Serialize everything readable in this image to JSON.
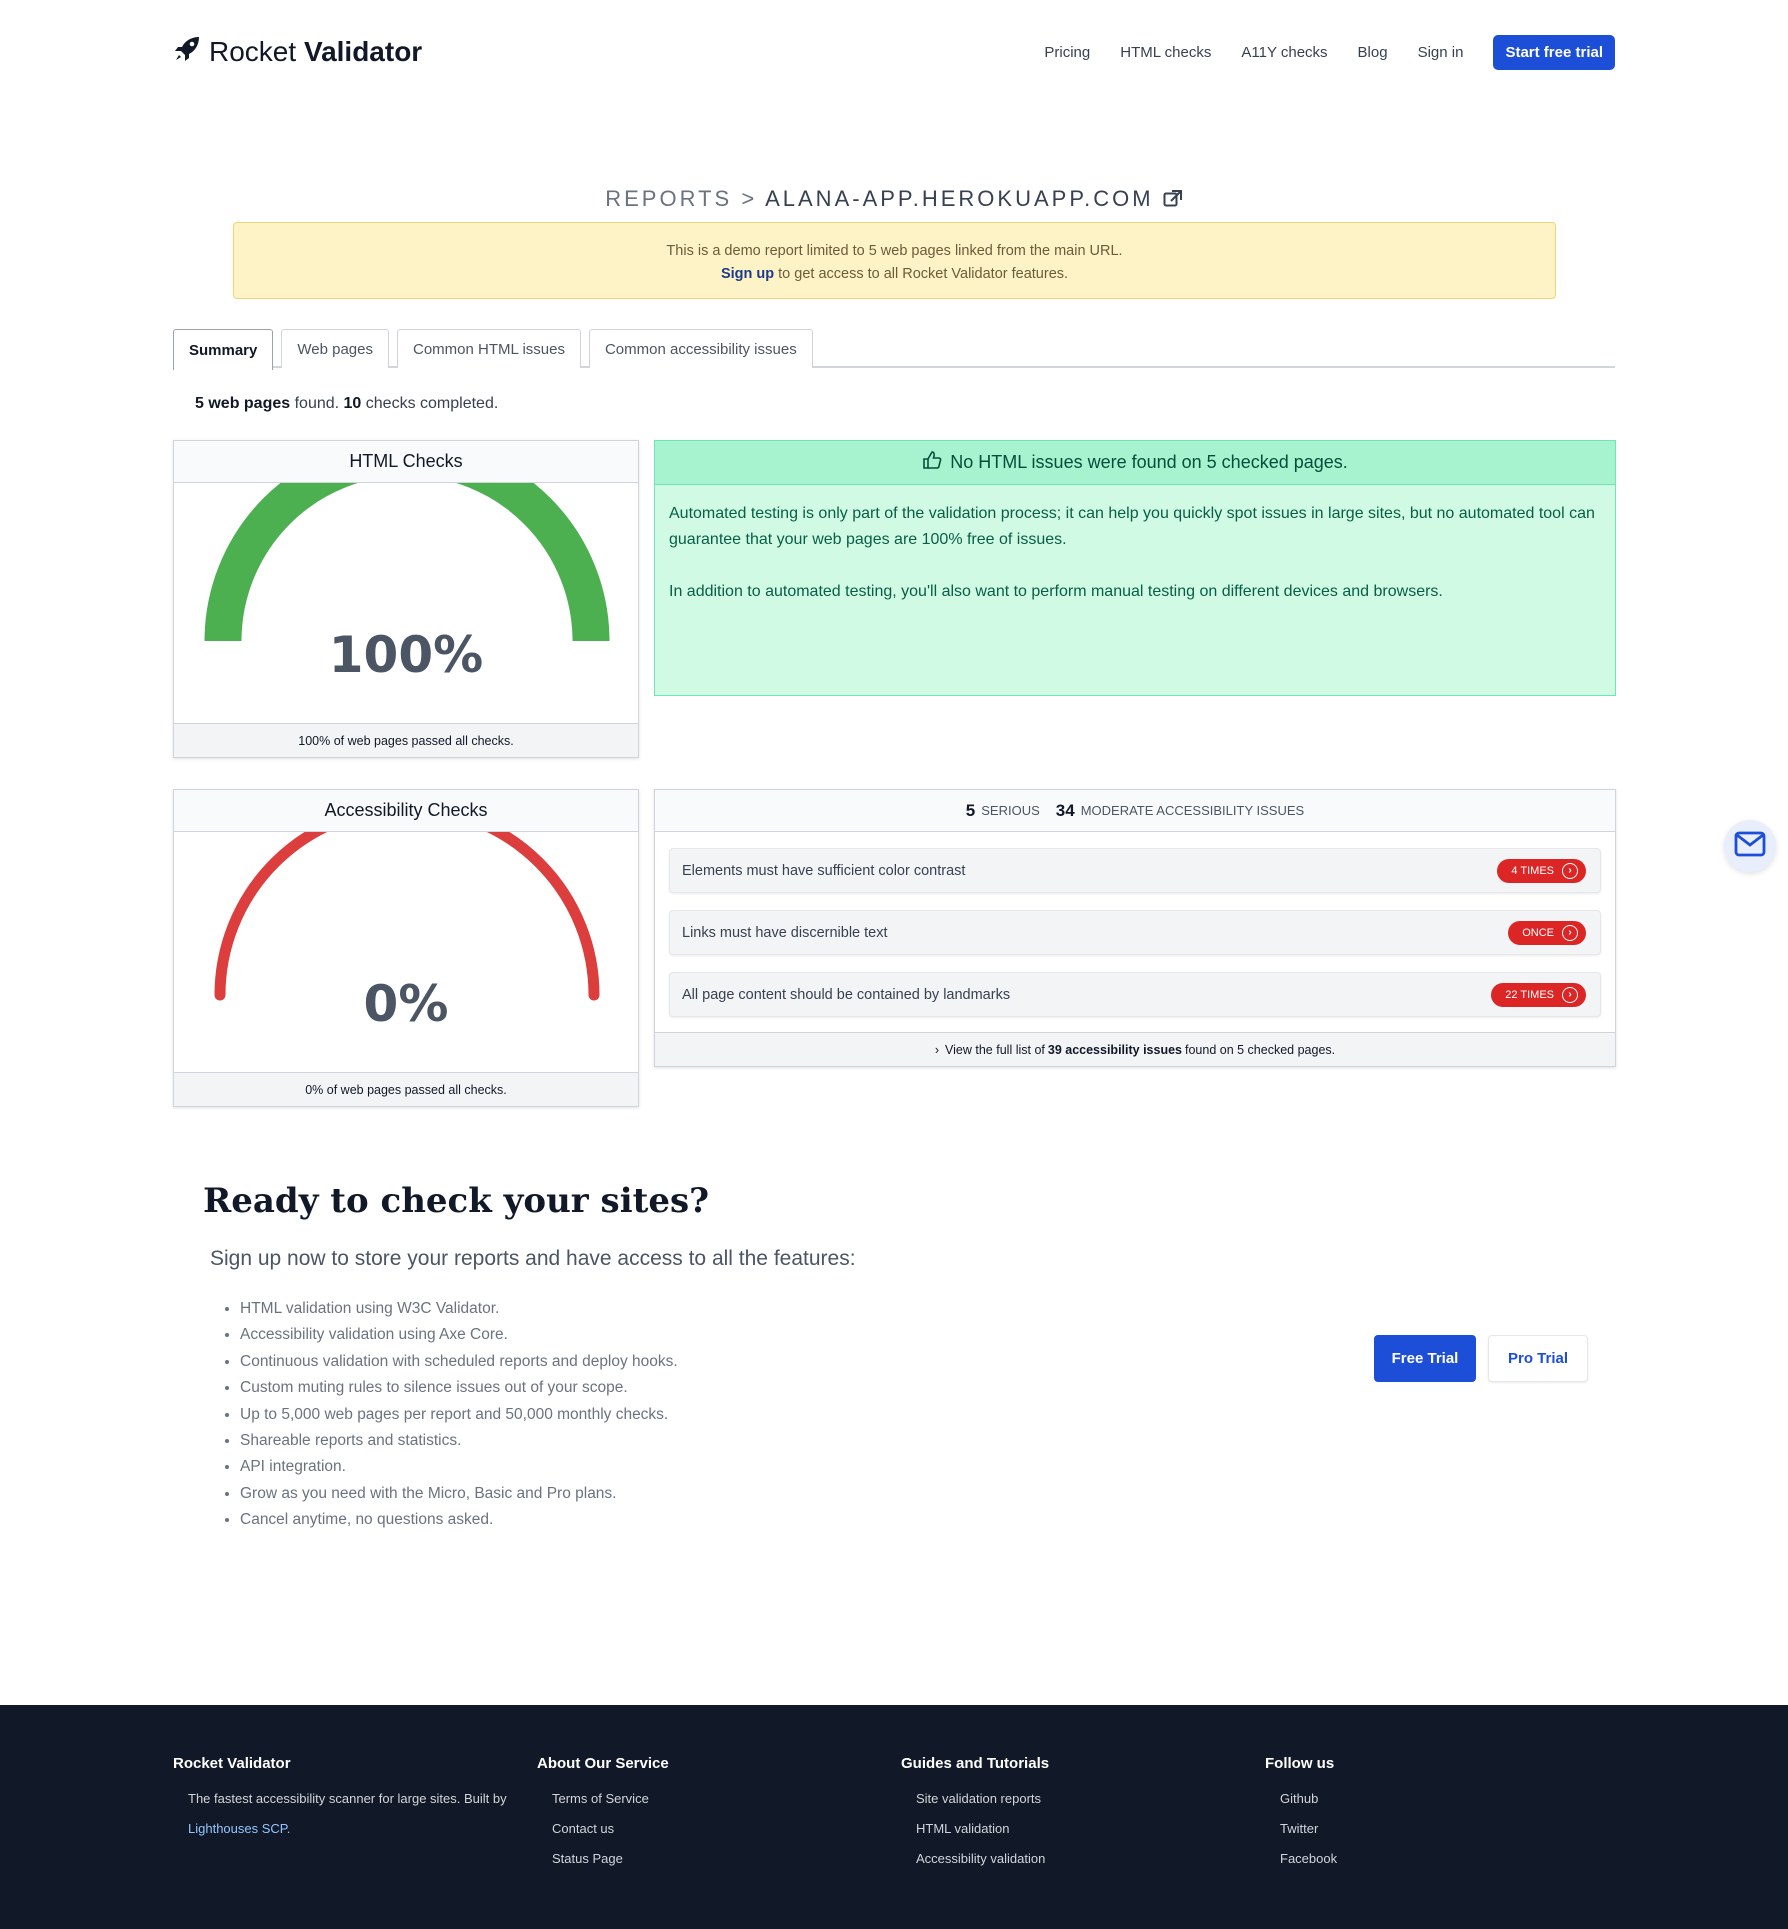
{
  "header": {
    "logo_light": "Rocket",
    "logo_bold": "Validator",
    "nav": [
      "Pricing",
      "HTML checks",
      "A11Y checks",
      "Blog",
      "Sign in"
    ],
    "cta": "Start free trial"
  },
  "breadcrumb": {
    "root": "REPORTS",
    "separator": ">",
    "site": "ALANA-APP.HEROKUAPP.COM"
  },
  "banner": {
    "line1": "This is a demo report limited to 5 web pages linked from the main URL.",
    "link": "Sign up",
    "line2_rest": " to get access to all Rocket Validator features."
  },
  "tabs": [
    "Summary",
    "Web pages",
    "Common HTML issues",
    "Common accessibility issues"
  ],
  "summary": {
    "pages_count": "5 web pages",
    "pages_found": " found. ",
    "checks_count": "10",
    "checks_completed": " checks completed."
  },
  "html_checks": {
    "title": "HTML Checks",
    "percent": "100%",
    "value": 1.0,
    "color": "#4caf50",
    "footer": "100% of web pages passed all checks."
  },
  "success": {
    "title": "No HTML issues were found on 5 checked pages.",
    "p1": "Automated testing is only part of the validation process; it can help you quickly spot issues in large sites, but no automated tool can guarantee that your web pages are 100% free of issues.",
    "p2": "In addition to automated testing, you'll also want to perform manual testing on different devices and browsers."
  },
  "a11y_checks": {
    "title": "Accessibility Checks",
    "percent": "0%",
    "value": 0.0,
    "color": "#dc3d3d",
    "footer": "0% of web pages passed all checks."
  },
  "a11y_issues": {
    "serious_count": "5",
    "serious_label": "SERIOUS",
    "moderate_count": "34",
    "moderate_label": "MODERATE ACCESSIBILITY ISSUES",
    "items": [
      {
        "text": "Elements must have sufficient color contrast",
        "badge": "4 TIMES"
      },
      {
        "text": "Links must have discernible text",
        "badge": "ONCE"
      },
      {
        "text": "All page content should be contained by landmarks",
        "badge": "22 TIMES"
      }
    ],
    "footer_pre": "View the full list of ",
    "footer_bold": "39 accessibility issues",
    "footer_post": " found on 5 checked pages."
  },
  "cta_section": {
    "title": "Ready to check your sites?",
    "subtitle": "Sign up now to store your reports and have access to all the features:",
    "features": [
      "HTML validation using W3C Validator.",
      "Accessibility validation using Axe Core.",
      "Continuous validation with scheduled reports and deploy hooks.",
      "Custom muting rules to silence issues out of your scope.",
      "Up to 5,000 web pages per report and 50,000 monthly checks.",
      "Shareable reports and statistics.",
      "API integration.",
      "Grow as you need with the Micro, Basic and Pro plans.",
      "Cancel anytime, no questions asked."
    ],
    "free_trial": "Free Trial",
    "pro_trial": "Pro Trial"
  },
  "footer": {
    "col1_title": "Rocket Validator",
    "col1_text": "The fastest accessibility scanner for large sites. Built by",
    "col1_link": "Lighthouses SCP.",
    "col2_title": "About Our Service",
    "col2_items": [
      "Terms of Service",
      "Contact us",
      "Status Page"
    ],
    "col3_title": "Guides and Tutorials",
    "col3_items": [
      "Site validation reports",
      "HTML validation",
      "Accessibility validation"
    ],
    "col4_title": "Follow us",
    "col4_items": [
      "Github",
      "Twitter",
      "Facebook"
    ]
  }
}
